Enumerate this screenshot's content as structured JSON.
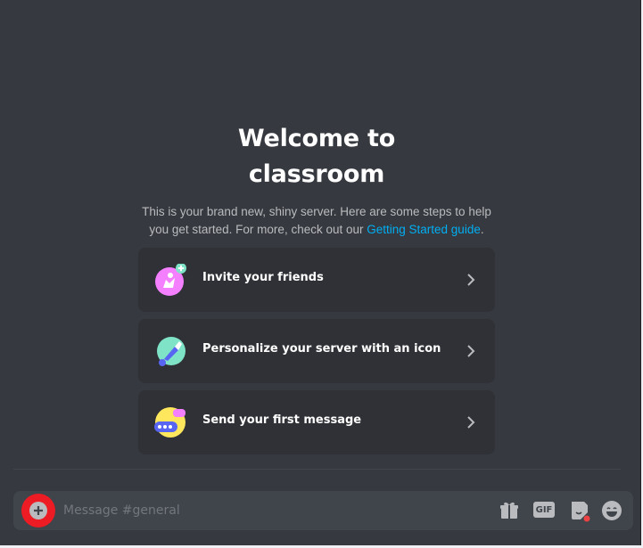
{
  "welcome": {
    "title_line1": "Welcome to",
    "title_line2": "classroom",
    "description": "This is your brand new, shiny server. Here are some steps to help you get started. For more, check out our ",
    "link_text": "Getting Started guide",
    "description_end": "."
  },
  "steps": [
    {
      "label": "Invite your friends",
      "icon": "invite-friends-icon"
    },
    {
      "label": "Personalize your server with an icon",
      "icon": "personalize-brush-icon"
    },
    {
      "label": "Send your first message",
      "icon": "send-message-icon"
    }
  ],
  "composer": {
    "placeholder": "Message #general",
    "gif_label": "GIF"
  },
  "colors": {
    "background": "#36393f",
    "card": "#2f3136",
    "link": "#00aff4",
    "highlight": "#ed1c24"
  }
}
